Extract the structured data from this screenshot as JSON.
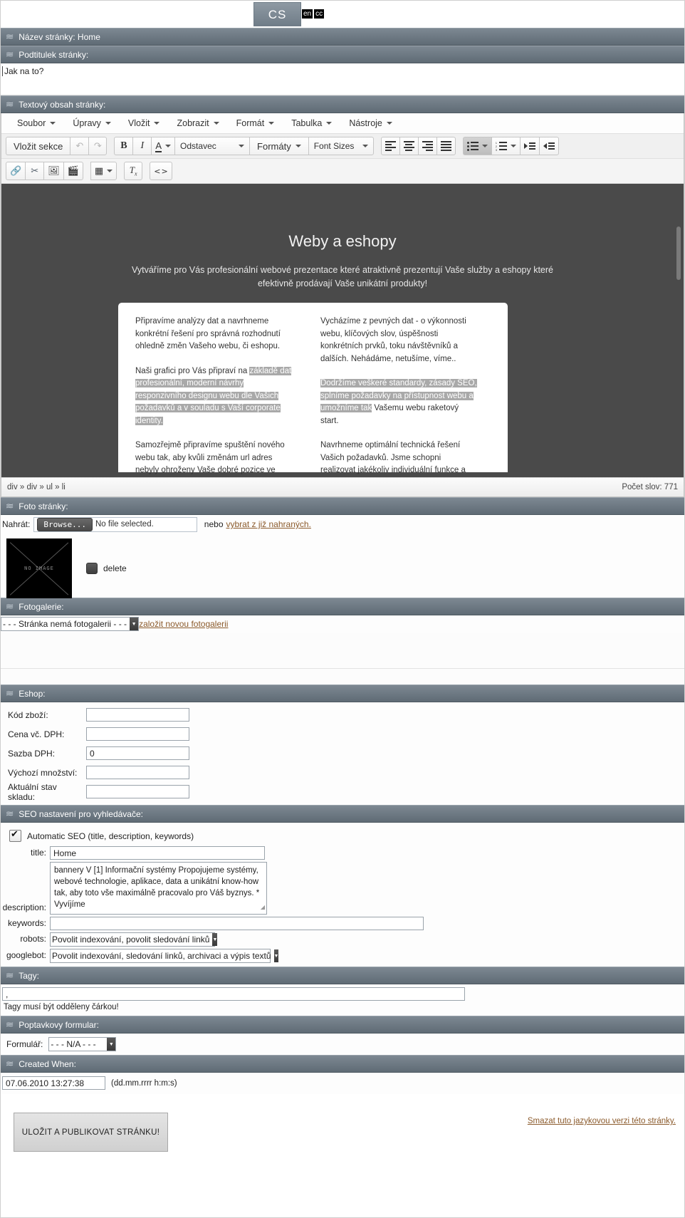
{
  "language": {
    "active_tab": "CS",
    "mini_tabs": [
      "en",
      "cc"
    ]
  },
  "sections": {
    "page_title": "Název stránky: Home",
    "page_subtitle": "Podtitulek stránky:",
    "page_text": "Textový obsah stránky:",
    "photo": "Foto stránky:",
    "gallery": "Fotogalerie:",
    "eshop": "Eshop:",
    "seo": "SEO nastavení pro vyhledávače:",
    "tags": "Tagy:",
    "form": "Poptavkovy formular:",
    "created": "Created When:"
  },
  "subtitle": {
    "value": "Jak na to?"
  },
  "editor": {
    "menu": [
      "Soubor",
      "Úpravy",
      "Vložit",
      "Zobrazit",
      "Formát",
      "Tabulka",
      "Nástroje"
    ],
    "toolbar": {
      "insert_section": "Vložit sekce",
      "undo": "undo-icon",
      "redo": "redo-icon",
      "bold": "B",
      "italic": "I",
      "textcolor": "A",
      "paragraph": "Odstavec",
      "formats": "Formáty",
      "fontsizes": "Font Sizes"
    },
    "content": {
      "title": "Weby a eshopy",
      "subtitle": "Vytváříme pro Vás profesionální webové prezentace které atraktivně prezentují Vaše služby a eshopy které efektivně prodávají Vaše unikátní produkty!",
      "left_col": [
        {
          "plain_before": "Připravíme analýzy dat a navrhneme konkrétní řešení pro správná rozhodnutí ohledně změn Vašeho webu, či eshopu.",
          "highlight": "",
          "plain_after": ""
        },
        {
          "plain_before": "Naši grafici pro Vás připraví na ",
          "highlight": "základě dat profesionální, moderní návrhy responzivního designu webu dle Vašich požadavků a v souladu s Vaší corporate identity.",
          "plain_after": ""
        },
        {
          "plain_before": "Samozřejmě připravíme spuštění nového webu tak, aby kvůli změnám url adres nebyly ohroženy Vaše dobré pozice ve vyhledávačích.",
          "highlight": "",
          "plain_after": ""
        }
      ],
      "right_col": [
        {
          "plain_before": "Vycházíme z pevných dat - o výkonnosti webu, klíčových slov, úspěšnosti konkrétních prvků, toku návštěvníků a dalších. Nehádáme, netušíme, víme..",
          "highlight": "",
          "plain_after": ""
        },
        {
          "plain_before": "",
          "highlight": "Dodržíme veškeré standardy, zásady SEO, splníme požadavky na přístupnost webu a umožníme tak",
          "plain_after": " Vašemu webu raketový start."
        },
        {
          "plain_before": "Navrhneme optimální technická řešení Vašich požadavků. Jsme schopni realizovat jakékoliv individuální funkce a propojení na externí systémy (účetní, skladové, informační systémy externí data, atd..) dle Vašich představ.",
          "highlight": "",
          "plain_after": ""
        }
      ]
    },
    "status": {
      "path": "div » div » ul » li",
      "wordcount": "Počet slov: 771"
    }
  },
  "photo": {
    "upload_label": "Nahrát:",
    "browse_button": "Browse...",
    "no_file": "No file selected.",
    "nebo": "nebo",
    "choose_link": "vybrat z již nahraných.",
    "thumb_text": "NO  IMAGE",
    "delete_label": "delete"
  },
  "gallery": {
    "selected": "- - - Stránka nemá fotogalerii - - -",
    "create_link": "založit novou fotogalerii"
  },
  "eshop": {
    "fields": [
      {
        "label": "Kód zboží:",
        "value": ""
      },
      {
        "label": "Cena vč. DPH:",
        "value": ""
      },
      {
        "label": "Sazba DPH:",
        "value": "0"
      },
      {
        "label": "Výchozí množství:",
        "value": ""
      },
      {
        "label": "Aktuální stav skladu:",
        "value": ""
      }
    ]
  },
  "seo": {
    "auto_label": "Automatic SEO (title, description, keywords)",
    "title_label": "title:",
    "title_value": "Home",
    "description_label": "description:",
    "description_value": "bannery V [1] Informační systémy Propojujeme systémy, webové technologie, aplikace, data a unikátní know-how tak, aby toto vše maximálně pracovalo pro Váš byznys. * Vyvíjíme",
    "keywords_label": "keywords:",
    "keywords_value": "",
    "robots_label": "robots:",
    "robots_value": "Povolit indexování, povolit sledování linků",
    "googlebot_label": "googlebot:",
    "googlebot_value": "Povolit indexování, sledování linků, archivaci a výpis textů"
  },
  "tags": {
    "value": ",",
    "note": "Tagy musí být odděleny čárkou!"
  },
  "form": {
    "label": "Formulář:",
    "value": "- - - N/A - - -"
  },
  "created": {
    "value": "07.06.2010 13:27:38",
    "hint": "(dd.mm.rrrr h:m:s)"
  },
  "footer": {
    "save_button": "ULOŽIT A PUBLIKOVAT STRÁNKU!",
    "delete_link": "Smazat tuto jazykovou verzi této stránky."
  },
  "colors": {
    "section_header": "#6f7b85",
    "editor_bg": "#4a4a4a",
    "link": "#8b5a2b",
    "highlight": "#a9a9a9"
  }
}
